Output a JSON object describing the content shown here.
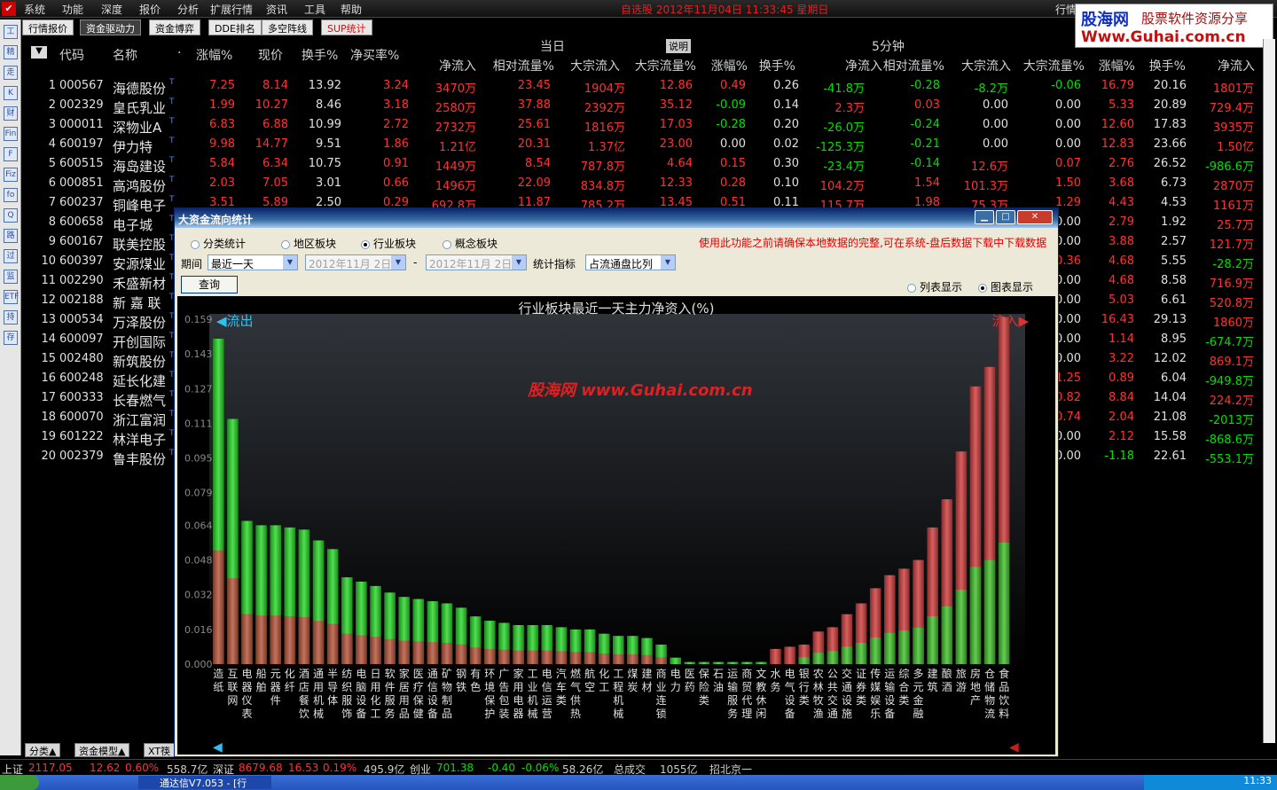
{
  "menu": [
    "系统",
    "功能",
    "深度",
    "报价",
    "分析",
    "扩展行情",
    "资讯",
    "工具",
    "帮助"
  ],
  "clock": "自选股  2012年11月04日 11:33:45 星期日",
  "hq_label": "行情",
  "ad": {
    "brand": "股海网",
    "slogan": "股票软件资源分享",
    "url": "Www.Guhai.com.cn"
  },
  "tabs": [
    "行情报价",
    "资金驱动力",
    "资金博弈",
    "DDE排名",
    "多空阵线",
    "SUP统计"
  ],
  "sidebar_icons": [
    "工",
    "精",
    "走",
    "K",
    "财",
    "Fin",
    "F",
    "Fiz",
    "fo",
    "Q",
    "路",
    "过",
    "监",
    "ETF",
    "持",
    "存"
  ],
  "table": {
    "h1": {
      "dd": "▼",
      "code": "代码",
      "name": "名称",
      "dot": "·",
      "chg": "涨幅%",
      "price": "现价",
      "turn": "换手%",
      "netratio": "净买率%",
      "today": "当日",
      "explain": "说明",
      "min5": "5分钟"
    },
    "h2": [
      "净流入",
      "相对流量%",
      "大宗流入",
      "大宗流量%",
      "涨幅%",
      "换手%",
      "净流入",
      "相对流量%",
      "大宗流入",
      "大宗流量%",
      "涨幅%",
      "换手%",
      "净流入"
    ],
    "rows": [
      [
        "1",
        "000567",
        "海德股份",
        "7.25",
        "8.14",
        "13.92",
        "3.24",
        "3470万",
        "23.45",
        "1904万",
        "12.86",
        "0.49",
        "0.26",
        "-41.8万",
        "-0.28",
        "-8.2万",
        "-0.06",
        "16.79",
        "20.16",
        "1801万"
      ],
      [
        "2",
        "002329",
        "皇氏乳业",
        "1.99",
        "10.27",
        "8.46",
        "3.18",
        "2580万",
        "37.88",
        "2392万",
        "35.12",
        "-0.09",
        "0.14",
        "2.3万",
        "0.03",
        "0.00",
        "0.00",
        "5.33",
        "20.89",
        "729.4万"
      ],
      [
        "3",
        "000011",
        "深物业A",
        "6.83",
        "6.88",
        "10.99",
        "2.72",
        "2732万",
        "25.61",
        "1816万",
        "17.03",
        "-0.28",
        "0.20",
        "-26.0万",
        "-0.24",
        "0.00",
        "0.00",
        "12.60",
        "17.83",
        "3935万"
      ],
      [
        "4",
        "600197",
        "伊力特",
        "9.98",
        "14.77",
        "9.51",
        "1.86",
        "1.21亿",
        "20.31",
        "1.37亿",
        "23.00",
        "0.00",
        "0.02",
        "-125.3万",
        "-0.21",
        "0.00",
        "0.00",
        "12.83",
        "23.66",
        "1.50亿"
      ],
      [
        "5",
        "600515",
        "海岛建设",
        "5.84",
        "6.34",
        "10.75",
        "0.91",
        "1449万",
        "8.54",
        "787.8万",
        "4.64",
        "0.15",
        "0.30",
        "-23.4万",
        "-0.14",
        "12.6万",
        "0.07",
        "2.76",
        "26.52",
        "-986.6万"
      ],
      [
        "6",
        "000851",
        "高鸿股份",
        "2.03",
        "7.05",
        "3.01",
        "0.66",
        "1496万",
        "22.09",
        "834.8万",
        "12.33",
        "0.28",
        "0.10",
        "104.2万",
        "1.54",
        "101.3万",
        "1.50",
        "3.68",
        "6.73",
        "2870万"
      ],
      [
        "7",
        "600237",
        "铜峰电子",
        "3.51",
        "5.89",
        "2.50",
        "0.29",
        "692.8万",
        "11.87",
        "785.2万",
        "13.45",
        "0.51",
        "0.11",
        "115.7万",
        "1.98",
        "75.3万",
        "1.29",
        "4.43",
        "4.53",
        "1161万"
      ],
      [
        "8",
        "600658",
        "电子城",
        "",
        "",
        "",
        "",
        "",
        "",
        "",
        "",
        "",
        "",
        "",
        "",
        "",
        "0.00",
        "2.79",
        "1.92",
        "25.7万"
      ],
      [
        "9",
        "600167",
        "联美控股",
        "",
        "",
        "",
        "",
        "",
        "",
        "",
        "",
        "",
        "",
        "",
        "",
        "",
        "0.00",
        "3.88",
        "2.57",
        "121.7万"
      ],
      [
        "10",
        "600397",
        "安源煤业",
        "",
        "",
        "",
        "",
        "",
        "",
        "",
        "",
        "",
        "",
        "",
        "",
        "",
        "0.36",
        "4.68",
        "5.55",
        "-28.2万"
      ],
      [
        "11",
        "002290",
        "禾盛新材",
        "",
        "",
        "",
        "",
        "",
        "",
        "",
        "",
        "",
        "",
        "",
        "",
        "",
        "0.00",
        "4.68",
        "8.58",
        "716.9万"
      ],
      [
        "12",
        "002188",
        "新 嘉 联",
        "",
        "",
        "",
        "",
        "",
        "",
        "",
        "",
        "",
        "",
        "",
        "",
        "",
        "0.00",
        "5.03",
        "6.61",
        "520.8万"
      ],
      [
        "13",
        "000534",
        "万泽股份",
        "",
        "",
        "",
        "",
        "",
        "",
        "",
        "",
        "",
        "",
        "",
        "",
        "",
        "0.00",
        "16.43",
        "29.13",
        "1860万"
      ],
      [
        "14",
        "600097",
        "开创国际",
        "",
        "",
        "",
        "",
        "",
        "",
        "",
        "",
        "",
        "",
        "",
        "",
        "",
        "0.00",
        "1.14",
        "8.95",
        "-674.7万"
      ],
      [
        "15",
        "002480",
        "新筑股份",
        "",
        "",
        "",
        "",
        "",
        "",
        "",
        "",
        "",
        "",
        "",
        "",
        "",
        "0.00",
        "3.22",
        "12.02",
        "869.1万"
      ],
      [
        "16",
        "600248",
        "延长化建",
        "",
        "",
        "",
        "",
        "",
        "",
        "",
        "",
        "",
        "",
        "",
        "",
        "",
        "1.25",
        "0.89",
        "6.04",
        "-949.8万"
      ],
      [
        "17",
        "600333",
        "长春燃气",
        "",
        "",
        "",
        "",
        "",
        "",
        "",
        "",
        "",
        "",
        "",
        "",
        "",
        "0.82",
        "8.84",
        "14.04",
        "224.2万"
      ],
      [
        "18",
        "600070",
        "浙江富润",
        "",
        "",
        "",
        "",
        "",
        "",
        "",
        "",
        "",
        "",
        "",
        "",
        "",
        "0.74",
        "2.04",
        "21.08",
        "-2013万"
      ],
      [
        "19",
        "601222",
        "林洋电子",
        "",
        "",
        "",
        "",
        "",
        "",
        "",
        "",
        "",
        "",
        "",
        "",
        "",
        "0.00",
        "2.12",
        "15.58",
        "-868.6万"
      ],
      [
        "20",
        "002379",
        "鲁丰股份",
        "",
        "",
        "",
        "",
        "",
        "",
        "",
        "",
        "",
        "",
        "",
        "",
        "",
        "0.00",
        "-1.18",
        "22.61",
        "-553.1万"
      ]
    ]
  },
  "bottom_tabs": [
    "分类▲",
    "资金模型▲",
    "XT筷"
  ],
  "status": {
    "sh_label": "上证",
    "sh": "2117.05",
    "sh_chg": "12.62",
    "sh_pct": "0.60%",
    "sh_amt": "558.7亿",
    "sz_label": "深证",
    "sz": "8679.68",
    "sz_chg": "16.53",
    "sz_pct": "0.19%",
    "sz_amt": "495.9亿",
    "cy_label": "创业",
    "cy": "701.38",
    "cy_chg": "-0.40",
    "cy_pct": "-0.06%",
    "cy_amt": "58.26亿",
    "total_label": "总成交",
    "total": "1055亿",
    "site": "招北京一"
  },
  "taskbar": {
    "task": "通达信V7.053 - [行",
    "time": "11:33"
  },
  "dialog": {
    "title": "大资金流向统计",
    "radios": [
      "分类统计",
      "地区板块",
      "行业板块",
      "概念板块"
    ],
    "radio_selected": 2,
    "note": "使用此功能之前请确保本地数据的完整,可在系统-盘后数据下载中下载数据",
    "period_label": "期间",
    "period": "最近一天",
    "date1": "2012年11月 2日",
    "dash": "-",
    "date2": "2012年11月 2日",
    "metric_label": "统计指标",
    "metric": "占流通盘比列",
    "query": "查询",
    "view_list": "列表显示",
    "view_chart": "图表显示",
    "view_selected": "chart"
  },
  "chart_data": {
    "type": "bar",
    "title": "行业板块最近一天主力净资入(%)",
    "out_label": "流出",
    "in_label": "流入",
    "watermark": "股海网  www.Guhai.com.cn",
    "ylim": [
      0,
      0.159
    ],
    "yticks": [
      "0.159",
      "0.143",
      "0.127",
      "0.111",
      "0.095",
      "0.079",
      "0.064",
      "0.048",
      "0.032",
      "0.016",
      "0.000"
    ],
    "categories": [
      "造纸",
      "互联网",
      "电器仪表",
      "船舶",
      "元器件",
      "化纤",
      "酒店餐饮",
      "通用机械",
      "半导体",
      "纺织服饰",
      "电脑设备",
      "日用化工",
      "软件服务",
      "家居用品",
      "医疗保健",
      "通信设备",
      "矿物制品",
      "钢铁",
      "有色",
      "环境保护",
      "广告包装",
      "家用电器",
      "工业机械",
      "电信运营",
      "汽车类",
      "燃气供热",
      "航空",
      "化工",
      "工程机械",
      "煤炭",
      "建材",
      "商业连锁",
      "电力",
      "医药",
      "保险类",
      "石油",
      "运输服务",
      "商贸代理",
      "文教休闲",
      "水务",
      "电气设备",
      "银行类",
      "农林牧渔",
      "公共交通",
      "交通设施",
      "证券类",
      "传媒娱乐",
      "运输设备",
      "综合类",
      "多元金融",
      "建筑",
      "酿酒",
      "旅游",
      "房地产",
      "仓储物流",
      "食品饮料"
    ],
    "series": [
      {
        "name": "流出",
        "values": [
          0.15,
          0.113,
          0.066,
          0.064,
          0.064,
          0.063,
          0.062,
          0.057,
          0.053,
          0.04,
          0.038,
          0.036,
          0.033,
          0.031,
          0.03,
          0.029,
          0.028,
          0.026,
          0.022,
          0.02,
          0.019,
          0.018,
          0.018,
          0.018,
          0.017,
          0.016,
          0.016,
          0.014,
          0.013,
          0.013,
          0.012,
          0.009,
          0.003,
          0.001,
          0.001,
          0.001,
          0.001,
          0.001,
          0.001
        ]
      },
      {
        "name": "流入",
        "values": [
          0.003,
          0.004,
          0.005,
          0.007,
          0.008,
          0.009,
          0.015,
          0.017,
          0.023,
          0.028,
          0.035,
          0.041,
          0.044,
          0.048,
          0.063,
          0.076,
          0.098,
          0.128,
          0.137,
          0.16
        ]
      }
    ]
  }
}
